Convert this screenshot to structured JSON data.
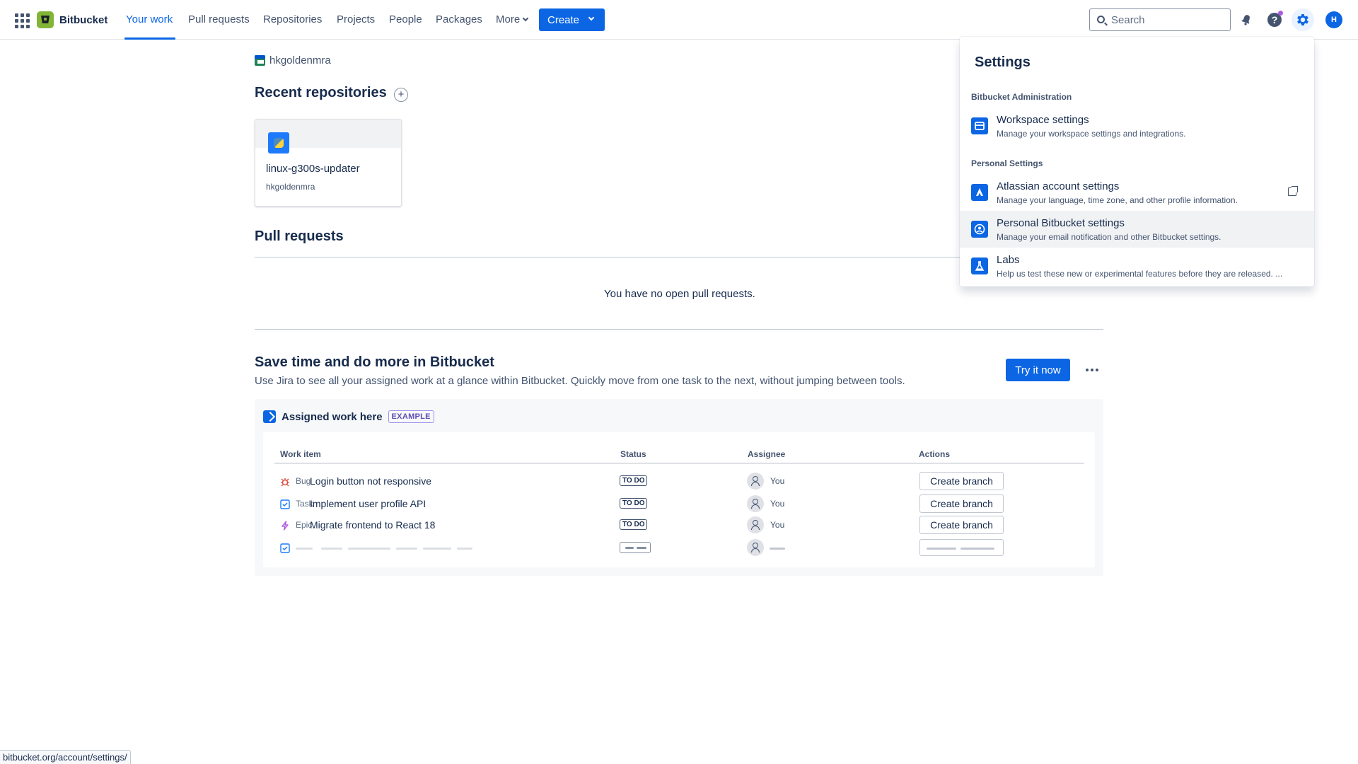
{
  "nav": {
    "brand": "Bitbucket",
    "links": [
      "Your work",
      "Pull requests",
      "Repositories",
      "Projects",
      "People",
      "Packages",
      "More"
    ],
    "create_label": "Create",
    "search_placeholder": "Search",
    "avatar_initial": "H",
    "help_glyph": "?",
    "colors": {
      "primary": "#0c66e4",
      "brand": "#82b536"
    }
  },
  "workspace": {
    "name": "hkgoldenmra"
  },
  "recent": {
    "title": "Recent repositories",
    "add_glyph": "+",
    "repos": [
      {
        "name": "linux-g300s-updater",
        "owner": "hkgoldenmra",
        "icon": "python-icon"
      }
    ]
  },
  "pull_requests": {
    "title": "Pull requests",
    "empty_text": "You have no open pull requests."
  },
  "promo": {
    "title": "Save time and do more in Bitbucket",
    "description": "Use Jira to see all your assigned work at a glance within Bitbucket. Quickly move from one task to the next, without jumping between tools.",
    "try_label": "Try it now",
    "example_title": "Assigned work here",
    "example_badge": "EXAMPLE",
    "columns": [
      "Work item",
      "Status",
      "Assignee",
      "Actions"
    ],
    "rows": [
      {
        "type": "Bug",
        "title": "Login button not responsive",
        "status": "TO DO",
        "assignee": "You",
        "action": "Create branch",
        "icon": "bug-icon"
      },
      {
        "type": "Task",
        "title": "Implement user profile API",
        "status": "TO DO",
        "assignee": "You",
        "action": "Create branch",
        "icon": "task-icon"
      },
      {
        "type": "Epic",
        "title": "Migrate frontend to React 18",
        "status": "TO DO",
        "assignee": "You",
        "action": "Create branch",
        "icon": "epic-icon"
      }
    ]
  },
  "settings_menu": {
    "title": "Settings",
    "sections": [
      {
        "label": "Bitbucket Administration",
        "items": [
          {
            "name": "Workspace settings",
            "description": "Manage your workspace settings and integrations.",
            "icon": "workspace-icon"
          }
        ]
      },
      {
        "label": "Personal Settings",
        "items": [
          {
            "name": "Atlassian account settings",
            "description": "Manage your language, time zone, and other profile information.",
            "icon": "atlassian-icon"
          },
          {
            "name": "Personal Bitbucket settings",
            "description": "Manage your email notification and other Bitbucket settings.",
            "icon": "person-icon"
          },
          {
            "name": "Labs",
            "description": "Help us test these new or experimental features before they are released. ...",
            "icon": "flask-icon"
          }
        ]
      }
    ]
  },
  "statusbar": {
    "url": "bitbucket.org/account/settings/"
  }
}
